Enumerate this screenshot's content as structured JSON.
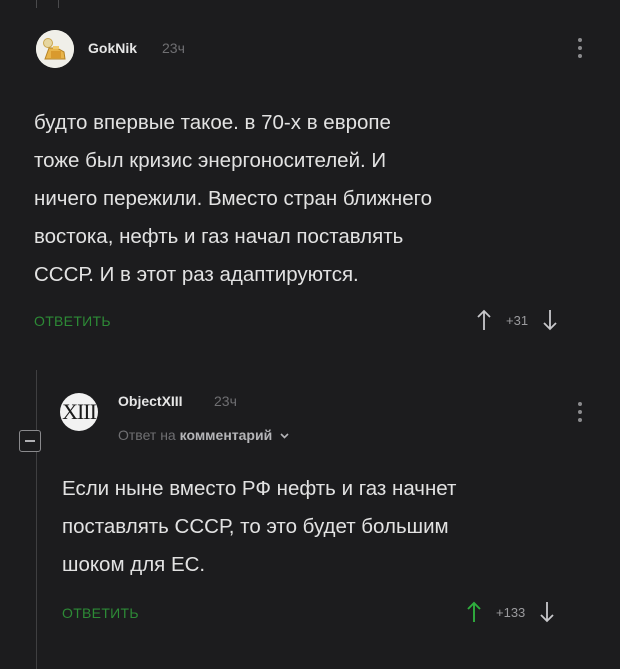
{
  "comment1": {
    "author": "GokNik",
    "time": "23ч",
    "text": "будто впервые такое. в 70-х в европе\nтоже был кризис энергоносителей. И\nничего пережили. Вместо стран ближнего\nвостока, нефть и газ начал поставлять\nСССР.  И в этот раз адаптируются.",
    "reply_label": "ОТВЕТИТЬ",
    "rating": "+31",
    "icons": [
      "avatar",
      "more-icon",
      "upvote-arrow-icon",
      "downvote-arrow-icon"
    ]
  },
  "comment2": {
    "author": "ObjectXIII",
    "time": "23ч",
    "avatar_text": "XIII",
    "reply_prefix": "Ответ на",
    "reply_target": "комментарий",
    "text": "Если ныне вместо РФ нефть и газ начнет\nпоставлять СССР, то это будет большим\nшоком для ЕС.",
    "reply_label": "ОТВЕТИТЬ",
    "rating": "+133",
    "icons": [
      "avatar",
      "more-icon",
      "chevron-down-icon",
      "upvote-arrow-icon",
      "downvote-arrow-icon",
      "collapse-icon"
    ]
  },
  "colors": {
    "background": "#1c1c1e",
    "text": "#e2e2e2",
    "muted": "#6f6f72",
    "accent_green": "#2d8a36"
  }
}
